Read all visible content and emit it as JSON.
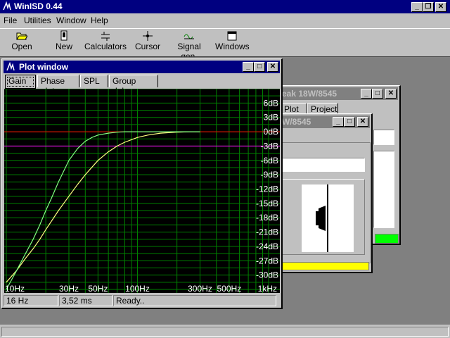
{
  "app": {
    "title": "WinISD 0.44"
  },
  "menu": [
    "File",
    "Utilities",
    "Window",
    "Help"
  ],
  "toolbar": [
    {
      "label": "Open",
      "icon": "folder-open-icon"
    },
    {
      "label": "New",
      "icon": "new-project-icon"
    },
    {
      "label": "Calculators",
      "icon": "calculator-icon"
    },
    {
      "label": "Cursor",
      "icon": "crosshair-cursor-icon"
    },
    {
      "label": "Signal gen.",
      "icon": "signal-generator-icon"
    },
    {
      "label": "Windows",
      "icon": "window-icon"
    }
  ],
  "project_window": {
    "title": "eak 18W/8545",
    "tabs": [
      "Plot",
      "Project"
    ]
  },
  "driver_window": {
    "title": "W/8545"
  },
  "plot_window": {
    "title": "Plot window",
    "tabs": [
      "Gain",
      "Phase plot",
      "SPL",
      "Group delay"
    ],
    "active_tab": "Gain",
    "status": {
      "freq": "16 Hz",
      "delay": "3,52 ms",
      "message": "Ready.."
    }
  },
  "colors": {
    "plot_bg": "#000000",
    "grid": "#008000",
    "reference_line": "#ff0000",
    "minus3db_line": "#ff00ff",
    "series1": "#ffff80",
    "series2": "#80ff80",
    "yellow_bar": "#ffff00",
    "green_bar": "#00ff00"
  },
  "chart_data": {
    "type": "line",
    "xlabel": "",
    "ylabel": "",
    "x_scale": "log",
    "xlim": [
      10,
      1000
    ],
    "ylim": [
      -33,
      9
    ],
    "y_ticks": [
      6,
      3,
      0,
      -3,
      -6,
      -9,
      -12,
      -15,
      -18,
      -21,
      -24,
      -27,
      -30
    ],
    "y_tick_labels": [
      "6dB",
      "3dB",
      "0dB",
      "-3dB",
      "-6dB",
      "-9dB",
      "-12dB",
      "-15dB",
      "-18dB",
      "-21dB",
      "-24dB",
      "-27dB",
      "-30dB"
    ],
    "x_ticks": [
      10,
      30,
      50,
      100,
      300,
      500,
      1000
    ],
    "x_tick_labels": [
      "10Hz",
      "30Hz",
      "50Hz",
      "100Hz",
      "300Hz",
      "500Hz",
      "1kHz"
    ],
    "reference_lines": [
      0,
      -3
    ],
    "grid": true,
    "series": [
      {
        "x": [
          10,
          12,
          14,
          16,
          18,
          20,
          25,
          30,
          35,
          40,
          50,
          60,
          70,
          80,
          100,
          120,
          150,
          200,
          250,
          300
        ],
        "y": [
          -31.5,
          -29,
          -26.5,
          -24.5,
          -22.5,
          -20.5,
          -16.5,
          -13.5,
          -11,
          -9,
          -6,
          -4.2,
          -3,
          -2.2,
          -1.2,
          -0.7,
          -0.3,
          -0.1,
          0,
          0
        ]
      },
      {
        "x": [
          10,
          12,
          14,
          16,
          18,
          20,
          22,
          25,
          30,
          35,
          40,
          45,
          50,
          60,
          70,
          80,
          100,
          150,
          200,
          300
        ],
        "y": [
          -33,
          -29,
          -25.5,
          -22.5,
          -19.5,
          -16.5,
          -14,
          -10.5,
          -6,
          -3.5,
          -2,
          -1.2,
          -0.7,
          -0.3,
          -0.1,
          0,
          0,
          0,
          0,
          0
        ]
      }
    ]
  }
}
